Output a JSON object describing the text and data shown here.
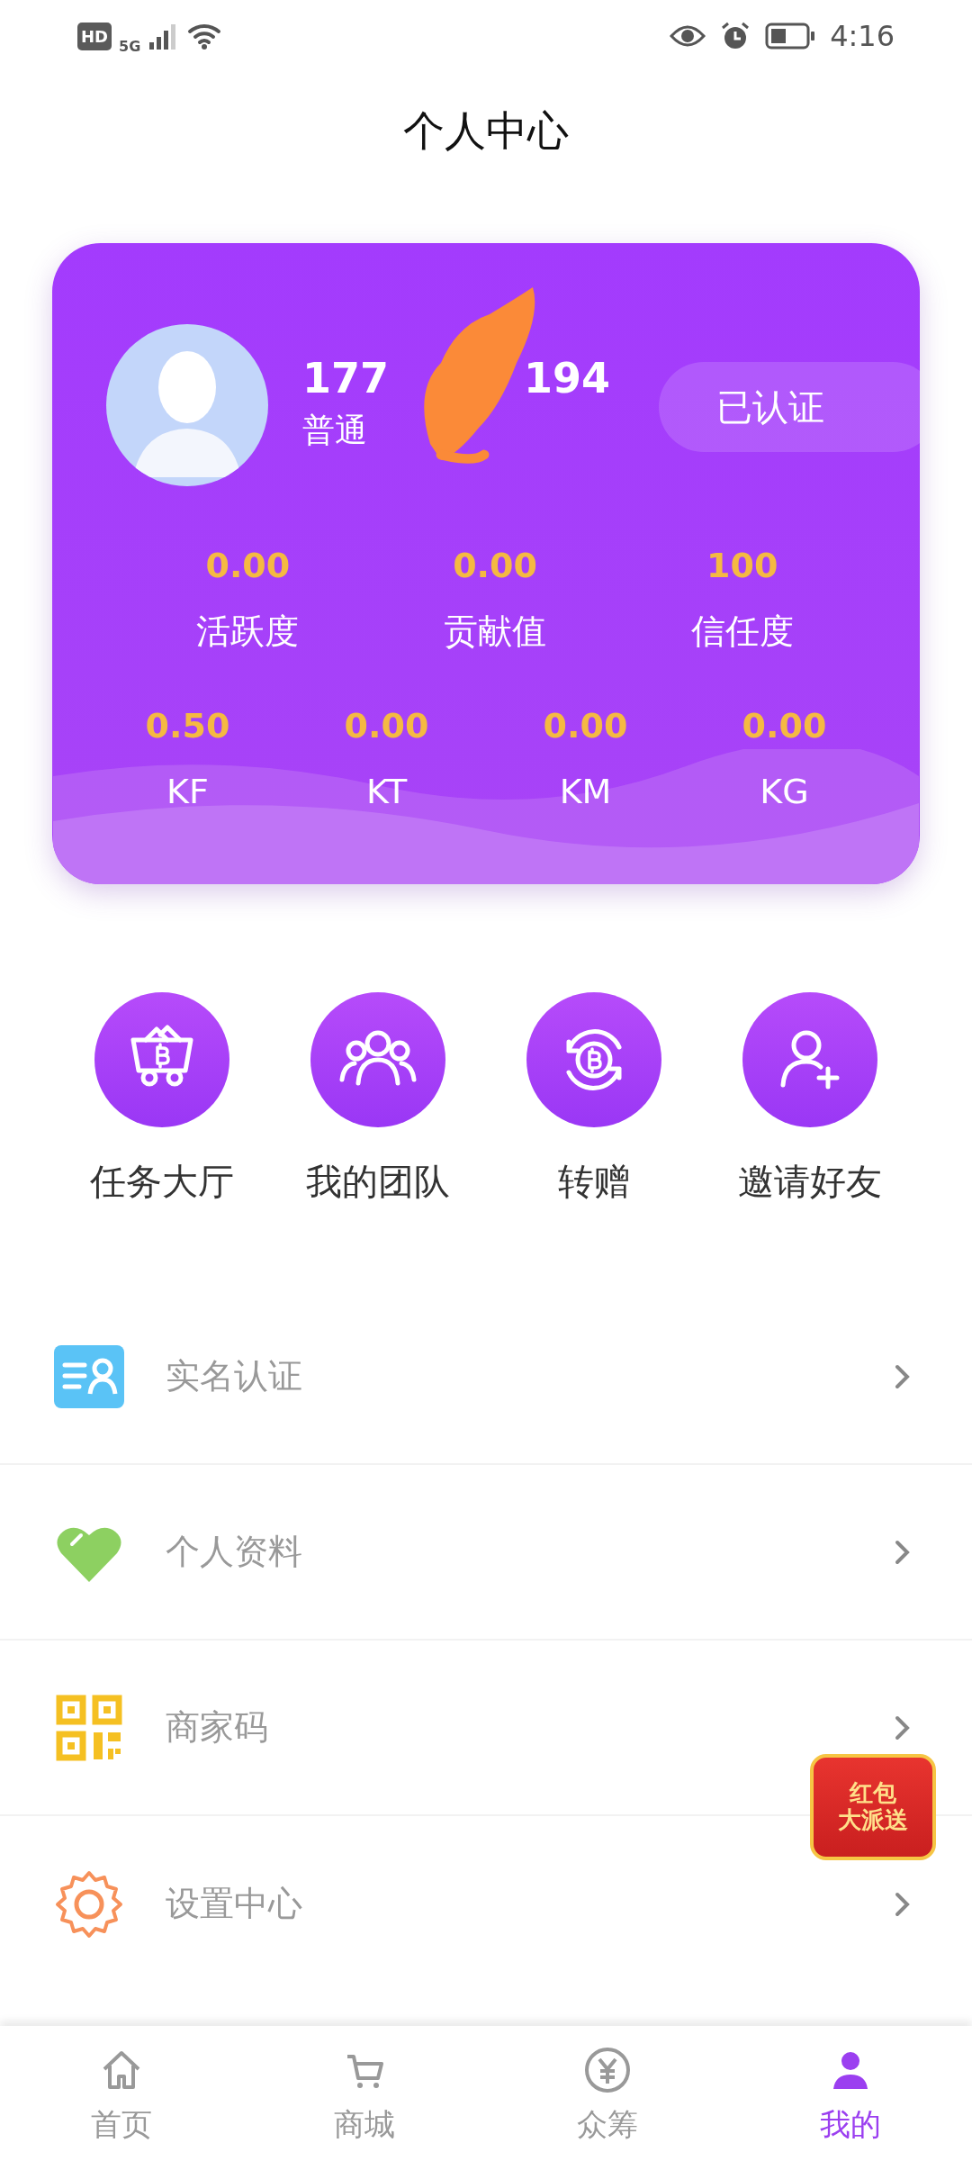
{
  "status_bar": {
    "hd": "HD",
    "network": "5G",
    "time": "4:16"
  },
  "header": {
    "title": "个人中心"
  },
  "profile": {
    "phone_start": "177",
    "phone_end": "194",
    "member_type": "普通",
    "verified": "已认证"
  },
  "stats": [
    {
      "value": "0.00",
      "label": "活跃度"
    },
    {
      "value": "0.00",
      "label": "贡献值"
    },
    {
      "value": "100",
      "label": "信任度"
    }
  ],
  "tokens": [
    {
      "value": "0.50",
      "label": "KF"
    },
    {
      "value": "0.00",
      "label": "KT"
    },
    {
      "value": "0.00",
      "label": "KM"
    },
    {
      "value": "0.00",
      "label": "KG"
    }
  ],
  "actions": [
    {
      "label": "任务大厅"
    },
    {
      "label": "我的团队"
    },
    {
      "label": "转赠"
    },
    {
      "label": "邀请好友"
    }
  ],
  "menu": [
    {
      "label": "实名认证"
    },
    {
      "label": "个人资料"
    },
    {
      "label": "商家码"
    },
    {
      "label": "设置中心"
    }
  ],
  "floating_button": {
    "line1": "红包",
    "line2": "大派送"
  },
  "bottom_nav": [
    {
      "label": "首页",
      "selected": false
    },
    {
      "label": "商城",
      "selected": false
    },
    {
      "label": "众筹",
      "selected": false
    },
    {
      "label": "我的",
      "selected": true
    }
  ]
}
